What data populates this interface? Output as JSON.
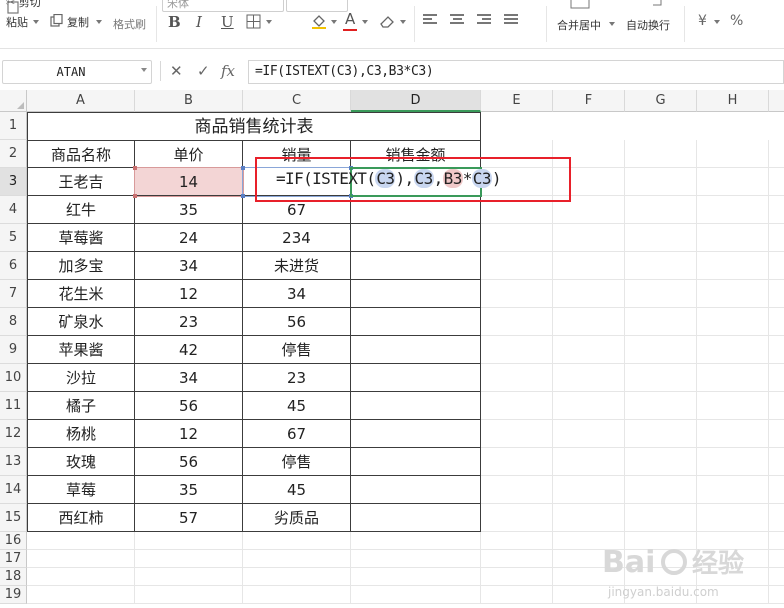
{
  "ribbon": {
    "paste_label": "粘贴",
    "copy_label": "复制",
    "format_painter_label": "格式刷",
    "cut_label": "剪切",
    "merge_label": "合并居中",
    "wrap_label": "自动换行",
    "currency_symbol": "¥",
    "percent_symbol": "%",
    "font_name": "宋体"
  },
  "formula_bar": {
    "name_box": "ATAN",
    "cancel_icon": "✕",
    "enter_icon": "✓",
    "fx_label": "fx",
    "formula": "=IF(ISTEXT(C3),C3,B3*C3)"
  },
  "columns": [
    "A",
    "B",
    "C",
    "D",
    "E",
    "F",
    "G",
    "H"
  ],
  "selected_column": "D",
  "rows": [
    "1",
    "2",
    "3",
    "4",
    "5",
    "6",
    "7",
    "8",
    "9",
    "10",
    "11",
    "12",
    "13",
    "14",
    "15",
    "16",
    "17",
    "18",
    "19"
  ],
  "selected_row": "3",
  "sheet": {
    "title": "商品销售统计表",
    "headers": [
      "商品名称",
      "单价",
      "销量",
      "销售金额"
    ],
    "data": [
      [
        "王老吉",
        "14",
        ""
      ],
      [
        "红牛",
        "35",
        "67"
      ],
      [
        "草莓酱",
        "24",
        "234"
      ],
      [
        "加多宝",
        "34",
        "未进货"
      ],
      [
        "花生米",
        "12",
        "34"
      ],
      [
        "矿泉水",
        "23",
        "56"
      ],
      [
        "苹果酱",
        "42",
        "停售"
      ],
      [
        "沙拉",
        "34",
        "23"
      ],
      [
        "橘子",
        "56",
        "45"
      ],
      [
        "杨桃",
        "12",
        "67"
      ],
      [
        "玫瑰",
        "56",
        "停售"
      ],
      [
        "草莓",
        "35",
        "45"
      ],
      [
        "西红柿",
        "57",
        "劣质品"
      ]
    ]
  },
  "edit": {
    "prefix": "=IF(ISTEXT(",
    "ref1": "C3",
    "mid1": "),",
    "ref2": "C3",
    "comma": ",",
    "ref3": "B3",
    "star": "*",
    "ref4": "C3",
    "suffix": ")"
  },
  "watermark": {
    "brand": "Bai",
    "brand2": "经验",
    "url": "jingyan.baidu.com"
  },
  "colors": {
    "b3_ref": "#f3d5d5",
    "c3_ref": "#c8d6f0",
    "annotation": "#e8202a",
    "selected_header_line": "#3a9a5a"
  }
}
